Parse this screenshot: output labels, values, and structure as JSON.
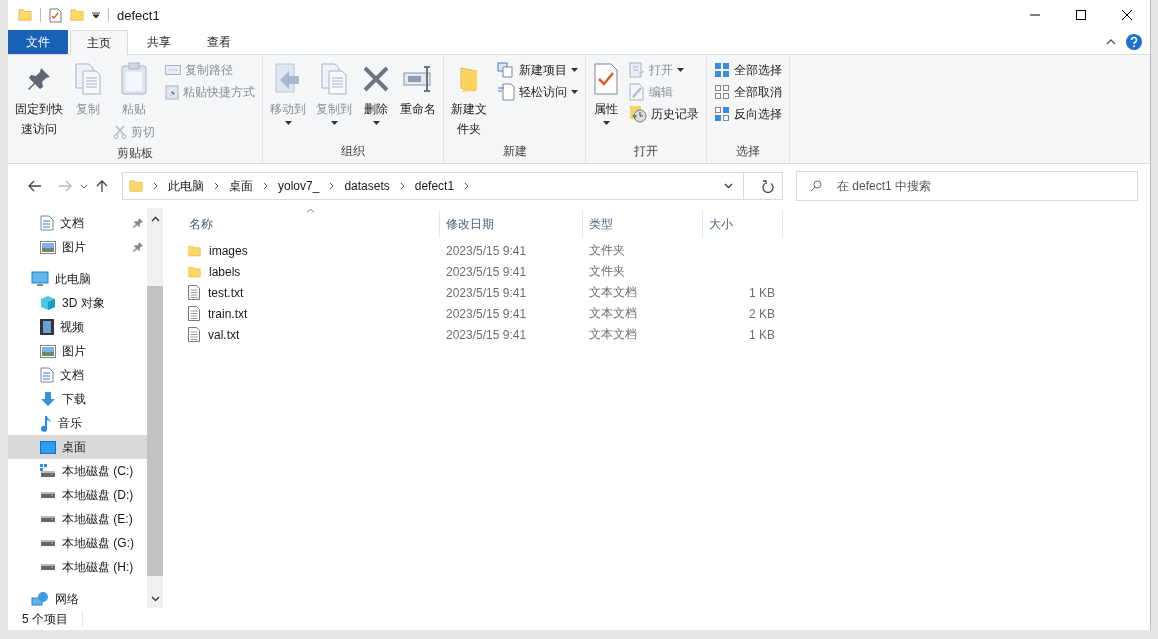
{
  "window": {
    "title": "defect1"
  },
  "ribbon_tabs": [
    {
      "label": "文件",
      "kind": "file",
      "selected": false
    },
    {
      "label": "主页",
      "kind": "tab",
      "selected": true
    },
    {
      "label": "共享",
      "kind": "tab",
      "selected": false
    },
    {
      "label": "查看",
      "kind": "tab",
      "selected": false
    }
  ],
  "ribbon_groups": [
    {
      "name": "剪贴板",
      "columns": [
        [
          {
            "kind": "pin",
            "label": "固定到快速访问",
            "disabled": false,
            "dropdown": false
          }
        ],
        [
          {
            "kind": "copy",
            "label": "复制",
            "disabled": true,
            "dropdown": false
          }
        ],
        [
          {
            "kind": "paste",
            "label": "粘贴",
            "disabled": true,
            "dropdown": false
          },
          {
            "kind": "cut",
            "label": "剪切",
            "disabled": true,
            "dropdown": false
          }
        ],
        [
          {
            "kind": "copy-path",
            "label": "复制路径",
            "disabled": true,
            "dropdown": false
          },
          {
            "kind": "paste-shortcut",
            "label": "粘贴快捷方式",
            "disabled": true,
            "dropdown": false
          }
        ]
      ]
    },
    {
      "name": "组织",
      "columns": [
        [
          {
            "kind": "move-to",
            "label": "移动到",
            "disabled": true,
            "dropdown": true
          }
        ],
        [
          {
            "kind": "copy-to",
            "label": "复制到",
            "disabled": true,
            "dropdown": true
          }
        ],
        [
          {
            "kind": "delete",
            "label": "删除",
            "disabled": false,
            "dropdown": true
          }
        ],
        [
          {
            "kind": "rename",
            "label": "重命名",
            "disabled": false,
            "dropdown": false
          }
        ]
      ]
    },
    {
      "name": "新建",
      "columns": [
        [
          {
            "kind": "new-folder",
            "label": "新建文件夹",
            "disabled": false,
            "dropdown": false
          }
        ],
        [
          {
            "kind": "new-item",
            "label": "新建项目",
            "disabled": false,
            "dropdown": true
          },
          {
            "kind": "easy-access",
            "label": "轻松访问",
            "disabled": false,
            "dropdown": true
          }
        ]
      ]
    },
    {
      "name": "打开",
      "columns": [
        [
          {
            "kind": "properties",
            "label": "属性",
            "disabled": false,
            "dropdown": true
          }
        ],
        [
          {
            "kind": "open",
            "label": "打开",
            "disabled": true,
            "dropdown": true
          },
          {
            "kind": "edit",
            "label": "编辑",
            "disabled": true,
            "dropdown": false
          },
          {
            "kind": "history",
            "label": "历史记录",
            "disabled": false,
            "dropdown": false
          }
        ]
      ]
    },
    {
      "name": "选择",
      "columns": [
        [
          {
            "kind": "select-all",
            "label": "全部选择",
            "disabled": false,
            "dropdown": false
          },
          {
            "kind": "select-none",
            "label": "全部取消",
            "disabled": false,
            "dropdown": false
          },
          {
            "kind": "invert",
            "label": "反向选择",
            "disabled": false,
            "dropdown": false
          }
        ]
      ]
    }
  ],
  "navigation": {
    "back_disabled": false,
    "forward_disabled": true
  },
  "address_bar": {
    "crumbs": [
      "此电脑",
      "桌面",
      "yolov7_",
      "datasets",
      "defect1"
    ]
  },
  "search": {
    "placeholder": "在 defect1 中搜索"
  },
  "sidebar": {
    "quick_access": [
      {
        "label": "文档",
        "kind": "documents",
        "pinned": true,
        "selected": false
      },
      {
        "label": "图片",
        "kind": "pictures",
        "pinned": true,
        "selected": false
      }
    ],
    "tree": [
      {
        "label": "此电脑",
        "kind": "pc",
        "selected": false,
        "children": [
          {
            "label": "3D 对象",
            "kind": "objects",
            "selected": false
          },
          {
            "label": "视频",
            "kind": "videos",
            "selected": false
          },
          {
            "label": "图片",
            "kind": "pictures",
            "selected": false
          },
          {
            "label": "文档",
            "kind": "documents",
            "selected": false
          },
          {
            "label": "下载",
            "kind": "downloads",
            "selected": false
          },
          {
            "label": "音乐",
            "kind": "music",
            "selected": false
          },
          {
            "label": "桌面",
            "kind": "desktop",
            "selected": true
          },
          {
            "label": "本地磁盘 (C:)",
            "kind": "system",
            "selected": false
          },
          {
            "label": "本地磁盘 (D:)",
            "kind": "drive",
            "selected": false
          },
          {
            "label": "本地磁盘 (E:)",
            "kind": "drive",
            "selected": false
          },
          {
            "label": "本地磁盘 (G:)",
            "kind": "drive",
            "selected": false
          },
          {
            "label": "本地磁盘 (H:)",
            "kind": "drive",
            "selected": false
          }
        ]
      },
      {
        "label": "网络",
        "kind": "network",
        "selected": false
      }
    ]
  },
  "file_list": {
    "columns": [
      "名称",
      "修改日期",
      "类型",
      "大小"
    ],
    "rows": [
      {
        "kind": "folder",
        "name": "images",
        "modified": "2023/5/15 9:41",
        "type": "文件夹",
        "selected": false
      },
      {
        "kind": "folder",
        "name": "labels",
        "modified": "2023/5/15 9:41",
        "type": "文件夹",
        "selected": false
      },
      {
        "kind": "file",
        "name": "test.txt",
        "modified": "2023/5/15 9:41",
        "type": "文本文档",
        "size": "1 KB",
        "selected": false
      },
      {
        "kind": "file",
        "name": "train.txt",
        "modified": "2023/5/15 9:41",
        "type": "文本文档",
        "size": "2 KB",
        "selected": false
      },
      {
        "kind": "file",
        "name": "val.txt",
        "modified": "2023/5/15 9:41",
        "type": "文本文档",
        "size": "1 KB",
        "selected": false
      }
    ]
  },
  "status_bar": {
    "item_count": "5 个项目"
  }
}
